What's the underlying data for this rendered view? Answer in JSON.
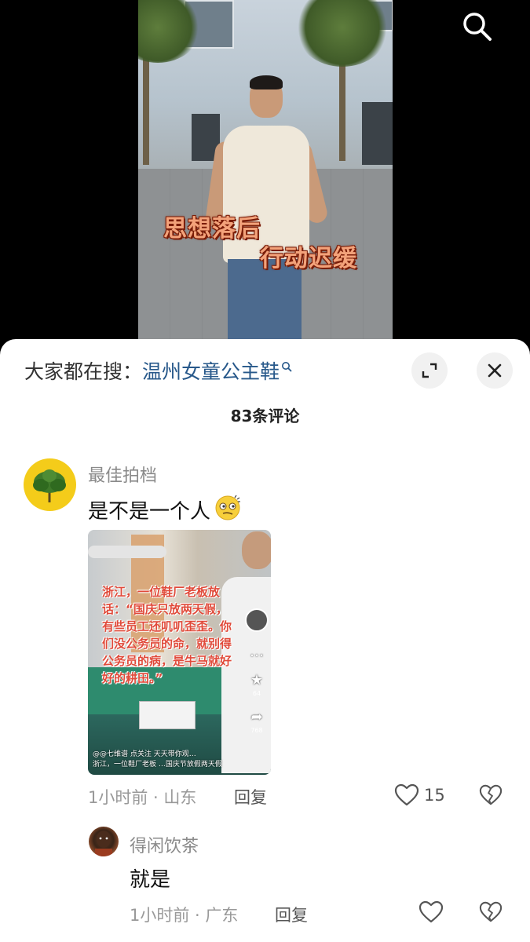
{
  "video": {
    "caption_line1": "思想落后",
    "caption_line2": "行动迟缓"
  },
  "sheet": {
    "trending_label": "大家都在搜：",
    "trending_keyword": "温州女童公主鞋",
    "comment_count": "83条评论"
  },
  "comments": [
    {
      "author": "最佳拍档",
      "text": "是不是一个人",
      "emoji": "thinking-face-emoji",
      "image": {
        "overlay_text": "浙江，一位鞋厂老板放\n话：“国庆只放两天假，\n有些员工还叽叽歪歪。你\n们没公务员的命，就别得\n公务员的病，是牛马就好\n好的耕田。”",
        "footer_line1": "@@七维谱 点关注 天天带你观…",
        "footer_line2": "浙江，一位鞋厂老板 …国庆节放假两天假",
        "likes": "64",
        "shares": "768"
      },
      "time_location": "1小时前 · 山东",
      "reply_label": "回复",
      "likes": "15"
    },
    {
      "author": "得闲饮茶",
      "text": "就是",
      "time_location": "1小时前 · 广东",
      "reply_label": "回复",
      "likes": ""
    }
  ]
}
